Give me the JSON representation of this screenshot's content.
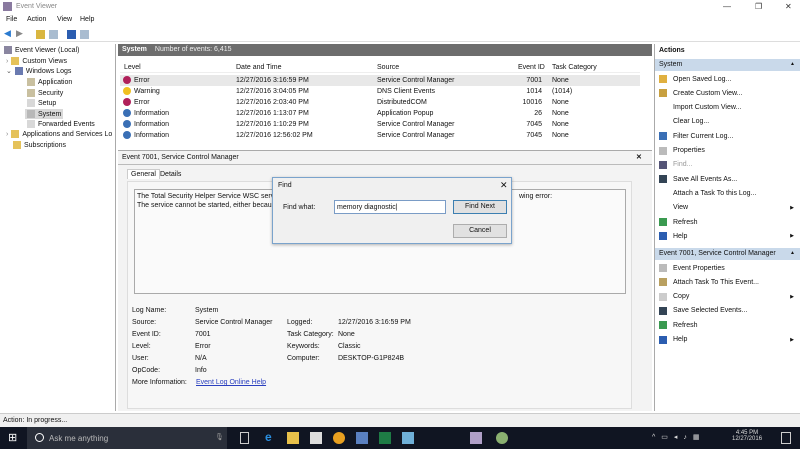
{
  "window": {
    "title": "Event Viewer",
    "min": "—",
    "max": "❐",
    "close": "✕"
  },
  "menu": [
    "File",
    "Action",
    "View",
    "Help"
  ],
  "tree": {
    "root": "Event Viewer (Local)",
    "items": [
      "Custom Views",
      "Windows Logs",
      "Application",
      "Security",
      "Setup",
      "System",
      "Forwarded Events",
      "Applications and Services Lo",
      "Subscriptions"
    ]
  },
  "list": {
    "title": "System",
    "count": "Number of events: 6,415",
    "columns": [
      "Level",
      "Date and Time",
      "Source",
      "Event ID",
      "Task Category"
    ],
    "rows": [
      {
        "level": "Error",
        "date": "12/27/2016 3:16:59 PM",
        "source": "Service Control Manager",
        "id": "7001",
        "cat": "None"
      },
      {
        "level": "Warning",
        "date": "12/27/2016 3:04:05 PM",
        "source": "DNS Client Events",
        "id": "1014",
        "cat": "(1014)"
      },
      {
        "level": "Error",
        "date": "12/27/2016 2:03:40 PM",
        "source": "DistributedCOM",
        "id": "10016",
        "cat": "None"
      },
      {
        "level": "Information",
        "date": "12/27/2016 1:13:07 PM",
        "source": "Application Popup",
        "id": "26",
        "cat": "None"
      },
      {
        "level": "Information",
        "date": "12/27/2016 1:10:29 PM",
        "source": "Service Control Manager",
        "id": "7045",
        "cat": "None"
      },
      {
        "level": "Information",
        "date": "12/27/2016 12:56:02 PM",
        "source": "Service Control Manager",
        "id": "7045",
        "cat": "None"
      }
    ]
  },
  "detail": {
    "title": "Event 7001, Service Control Manager",
    "close": "✕",
    "tabs": [
      "General",
      "Details"
    ],
    "msg1": "The Total Security Helper Service WSC service",
    "msg1_tail": "wing error:",
    "msg2": "The service cannot be started, either because",
    "fields": {
      "log_name_l": "Log Name:",
      "log_name": "System",
      "source_l": "Source:",
      "source": "Service Control Manager",
      "logged_l": "Logged:",
      "logged": "12/27/2016 3:16:59 PM",
      "id_l": "Event ID:",
      "id": "7001",
      "taskcat_l": "Task Category:",
      "taskcat": "None",
      "level_l": "Level:",
      "level": "Error",
      "kw_l": "Keywords:",
      "kw": "Classic",
      "user_l": "User:",
      "user": "N/A",
      "comp_l": "Computer:",
      "comp": "DESKTOP-G1P824B",
      "op_l": "OpCode:",
      "op": "Info",
      "more_l": "More Information:",
      "more": "Event Log Online Help"
    }
  },
  "actions": {
    "title": "Actions",
    "sec1": "System",
    "items1": [
      "Open Saved Log...",
      "Create Custom View...",
      "Import Custom View...",
      "Clear Log...",
      "Filter Current Log...",
      "Properties",
      "Find...",
      "Save All Events As...",
      "Attach a Task To this Log...",
      "View",
      "Refresh",
      "Help"
    ],
    "sec2": "Event 7001, Service Control Manager",
    "items2": [
      "Event Properties",
      "Attach Task To This Event...",
      "Copy",
      "Save Selected Events...",
      "Refresh",
      "Help"
    ]
  },
  "find": {
    "title": "Find",
    "label": "Find what:",
    "value": "memory diagnostic",
    "find_next": "Find Next",
    "cancel": "Cancel",
    "close": "✕"
  },
  "status": "Action:  In progress...",
  "taskbar": {
    "search": "Ask me anything",
    "time": "4:45 PM",
    "date": "12/27/2016"
  },
  "colors": {
    "error": "#b0205a",
    "warning": "#f0c020",
    "info": "#3a6fb5",
    "header": "#6d6d6d",
    "actions_header": "#c9d9ea",
    "taskbar": "#101522"
  }
}
